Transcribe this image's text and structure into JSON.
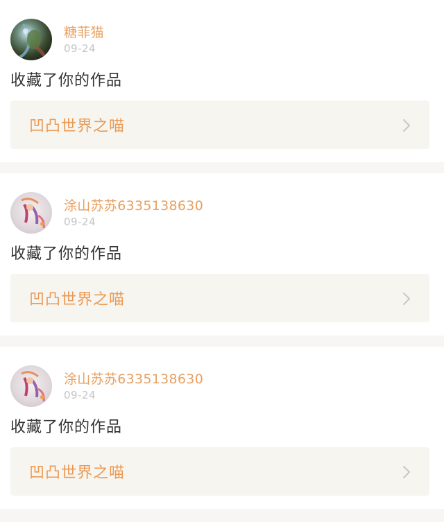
{
  "notifications": [
    {
      "username": "糖菲猫",
      "date": "09-24",
      "action": "收藏了你的作品",
      "work_title": "凹凸世界之喵",
      "avatar_icon": "avatar-green-character-icon"
    },
    {
      "username": "涂山苏苏6335138630",
      "date": "09-24",
      "action": "收藏了你的作品",
      "work_title": "凹凸世界之喵",
      "avatar_icon": "avatar-fox-girl-icon"
    },
    {
      "username": "涂山苏苏6335138630",
      "date": "09-24",
      "action": "收藏了你的作品",
      "work_title": "凹凸世界之喵",
      "avatar_icon": "avatar-fox-girl-icon"
    }
  ],
  "colors": {
    "username": "#e8a060",
    "timestamp": "#c4c4c4",
    "action_text": "#333333",
    "work_title": "#eb9a55",
    "work_bg": "#f6f5ef",
    "separator": "#f7f6f5"
  }
}
